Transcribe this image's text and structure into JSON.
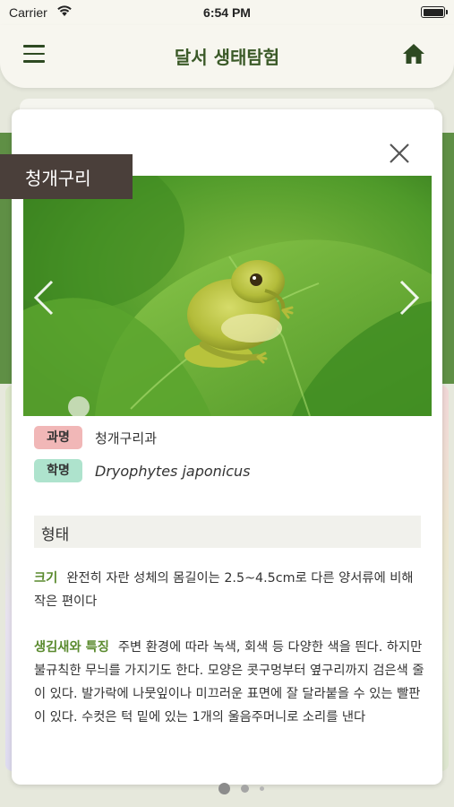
{
  "status_bar": {
    "carrier": "Carrier",
    "time": "6:54 PM"
  },
  "header": {
    "title": "달서 생태탐험",
    "menu_icon": "hamburger-menu-icon",
    "home_icon": "home-icon"
  },
  "species": {
    "name": "청개구리",
    "family_label": "과명",
    "family_value": "청개구리과",
    "scientific_label": "학명",
    "scientific_value": "Dryophytes japonicus"
  },
  "details": {
    "section_title": "형태",
    "size_label": "크기",
    "size_text": "완전히 자란 성체의 몸길이는 2.5~4.5cm로 다른 양서류에 비해 작은 편이다",
    "features_label": "생김새와 특징",
    "features_text": "주변 환경에 따라 녹색, 회색 등 다양한 색을 띈다. 하지만 불규칙한 무늬를 가지기도 한다. 모양은 콧구멍부터 옆구리까지 검은색 줄이 있다. 발가락에 나뭇잎이나 미끄러운 표면에 잘 달라붙을 수 있는 빨판이 있다. 수컷은 턱 밑에 있는 1개의 울음주머니로 소리를 낸다"
  },
  "colors": {
    "accent_green": "#5a8a2e",
    "title_green": "#3b5a28",
    "tag_brown": "#4a3f3a",
    "family_badge": "#f1b7b7",
    "sci_badge": "#aee3cd"
  },
  "pagination": {
    "current": 1,
    "total": 3
  }
}
